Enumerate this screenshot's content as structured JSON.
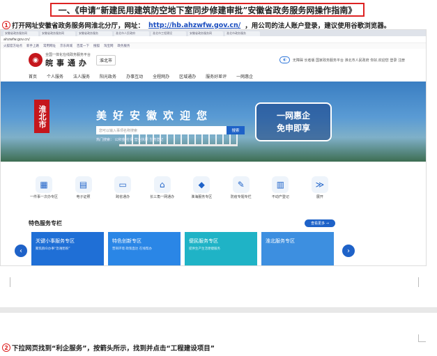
{
  "title": "一、《申请“新建民用建筑防空地下室同步修建审批”安徽省政务服务网操作指南》",
  "step1": {
    "num": "1",
    "text_before": "打开网址安徽省政务服务网淮北分厅，网址：",
    "url": "http://hb.ahzwfw.gov.cn/",
    "text_after": "，用公司的法人账户登录，建议使用谷歌浏览器。"
  },
  "step2": {
    "num": "2",
    "text": "下拉网页找到“利企服务”，按箭头所示，找到并点击“工程建设项目”"
  },
  "browser": {
    "tabs": [
      "安徽省政务服务网",
      "安徽省政务服务网",
      "安徽省政务服务",
      "淮北市人民政府",
      "淮北市工程建设",
      "安徽省政务服务网",
      "淮北市政务服务"
    ],
    "address": "ahzwfw.gov.cn/",
    "bookmarks": [
      "火狐官方站点",
      "新手上路",
      "常用网址",
      "京东商城",
      "百度一下",
      "搜狐",
      "淘宝网",
      "政务服务"
    ]
  },
  "site": {
    "logo_small": "全国一体化在线政务服务平台",
    "logo_big": "皖事通办",
    "city": "淮北市",
    "login_text": "无障碍 长者版 国家政务服务平台 淮北市人民政府 你好,欢迎您 登录 注册",
    "nav": [
      "首页",
      "个人服务",
      "法人服务",
      "阳光政务",
      "办事互动",
      "全程网办",
      "区域通办",
      "服务好差评",
      "一网惠企"
    ],
    "banner_tag": "淮北市",
    "welcome": "美好安徽欢迎您",
    "search_placeholder": "您可以输入事项名称搜索",
    "search_button": "搜索",
    "hot": "热门搜索：  公积金  社保  营业执照  生育登记",
    "slogan_line1": "一网惠企",
    "slogan_line2": "免申即享",
    "icons": [
      {
        "glyph": "▦",
        "label": "一件事一次办专区"
      },
      {
        "glyph": "▤",
        "label": "电子证照"
      },
      {
        "glyph": "▭",
        "label": "跨省通办"
      },
      {
        "glyph": "⌂",
        "label": "长三角一网通办"
      },
      {
        "glyph": "◆",
        "label": "淮海服务专区"
      },
      {
        "glyph": "✎",
        "label": "防疫专题专栏"
      },
      {
        "glyph": "▥",
        "label": "不动产登记"
      },
      {
        "glyph": "≫",
        "label": "展开"
      }
    ],
    "featured_title": "特色服务专栏",
    "more_button": "查看更多 →",
    "cards": [
      {
        "title": "关键小事服务专区",
        "sub": "聚焦群众办事“急难愁盼”",
        "color": "#1f6fd6"
      },
      {
        "title": "特色创新专区",
        "sub": "营商环境 政策直达 在线帮办",
        "color": "#2a86e6"
      },
      {
        "title": "便民服务专区",
        "sub": "提供生产生活便捷服务",
        "color": "#1fb3c6"
      },
      {
        "title": "淮北服务专区",
        "sub": "",
        "color": "#3d8fe0"
      }
    ]
  }
}
